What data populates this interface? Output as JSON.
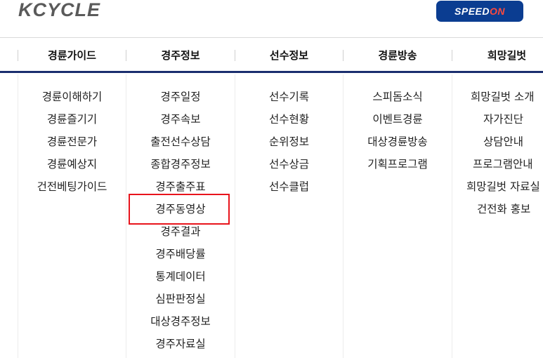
{
  "header": {
    "logo_text": "KCYCLE",
    "brand_button": {
      "main": "SPEED",
      "accent": "ON"
    },
    "accent_color": "#0b3d91",
    "highlight_color": "#e8141c"
  },
  "nav": {
    "tabs": [
      {
        "label": "경륜가이드"
      },
      {
        "label": "경주정보"
      },
      {
        "label": "선수정보"
      },
      {
        "label": "경륜방송"
      },
      {
        "label": "희망길벗"
      }
    ]
  },
  "menus": [
    {
      "items": [
        "경륜이해하기",
        "경륜즐기기",
        "경륜전문가",
        "경륜예상지",
        "건전베팅가이드"
      ]
    },
    {
      "items": [
        "경주일정",
        "경주속보",
        "출전선수상담",
        "종합경주정보",
        "경주출주표",
        "경주동영상",
        "경주결과",
        "경주배당률",
        "통계데이터",
        "심판판정실",
        "대상경주정보",
        "경주자료실"
      ]
    },
    {
      "items": [
        "선수기록",
        "선수현황",
        "순위정보",
        "선수상금",
        "선수클럽"
      ]
    },
    {
      "items": [
        "스피돔소식",
        "이벤트경륜",
        "대상경륜방송",
        "기획프로그램"
      ]
    },
    {
      "items": [
        "희망길벗 소개",
        "자가진단",
        "상담안내",
        "프로그램안내",
        "희망길벗 자료실",
        "건전화 홍보"
      ]
    }
  ]
}
